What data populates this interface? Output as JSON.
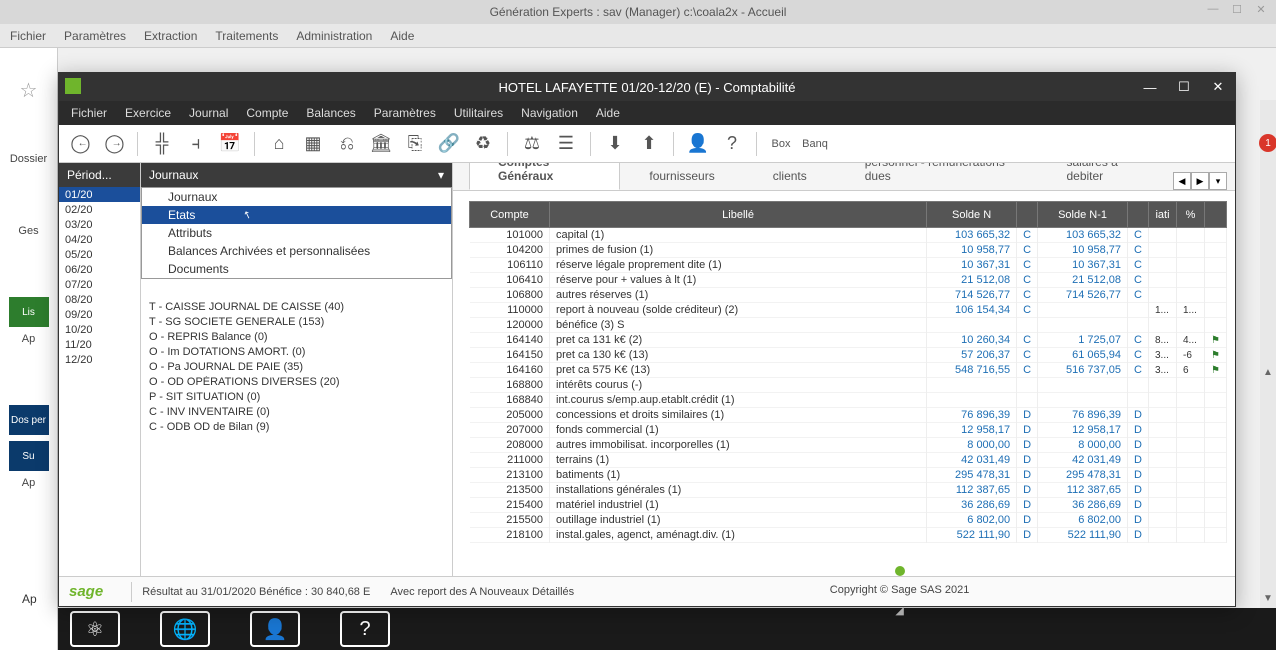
{
  "outer": {
    "title": "Génération Experts : sav (Manager) c:\\coala2x - Accueil",
    "menu": [
      "Fichier",
      "Paramètres",
      "Extraction",
      "Traitements",
      "Administration",
      "Aide"
    ]
  },
  "left": {
    "labels": [
      "Dossier",
      "Ges",
      "Lis",
      "Ap",
      "Dos per",
      "Su",
      "Ap"
    ]
  },
  "inner": {
    "title": "HOTEL LAFAYETTE 01/20-12/20 (E) - Comptabilité",
    "menu": [
      "Fichier",
      "Exercice",
      "Journal",
      "Compte",
      "Balances",
      "Paramètres",
      "Utilitaires",
      "Navigation",
      "Aide"
    ]
  },
  "toolbar_icons": [
    "arrow-left",
    "arrow-right",
    "split-h",
    "split-v",
    "calendar",
    "home",
    "grid",
    "org",
    "bank",
    "export",
    "link",
    "recycle",
    "scale",
    "list",
    "download",
    "upload",
    "person",
    "help",
    "box",
    "banq"
  ],
  "periods": {
    "header": "Périod...",
    "items": [
      "01/20",
      "02/20",
      "03/20",
      "04/20",
      "05/20",
      "06/20",
      "07/20",
      "08/20",
      "09/20",
      "10/20",
      "11/20",
      "12/20"
    ],
    "selected": "01/20"
  },
  "journaux": {
    "combo": "Journaux",
    "dropdown": [
      "Journaux",
      "Etats",
      "Attributs",
      "Balances Archivées et personnalisées",
      "Documents"
    ],
    "dropdown_selected": "Etats",
    "list": [
      "T - CAISSE JOURNAL DE CAISSE (40)",
      "T - SG SOCIETE GENERALE (153)",
      "O - REPRIS Balance (0)",
      "O - Im DOTATIONS AMORT. (0)",
      "O - Pa JOURNAL DE PAIE (35)",
      "O - OD OPÉRATIONS DIVERSES (20)",
      "P - SIT SITUATION (0)",
      "C - INV INVENTAIRE (0)",
      "C - ODB OD de Bilan (9)"
    ]
  },
  "tabs": {
    "items": [
      "Comptes Généraux",
      "fournisseurs",
      "clients",
      "personnel - rémunérations dues",
      "salaires a debiter"
    ],
    "active": "Comptes Généraux"
  },
  "table": {
    "headers": [
      "Compte",
      "Libellé",
      "Solde N",
      "",
      "Solde N-1",
      "",
      "iati",
      "%",
      ""
    ],
    "rows": [
      {
        "c": "101000",
        "l": "capital (1)",
        "n": "103 665,32",
        "cd": "C",
        "n1": "103 665,32",
        "cd1": "C",
        "a": "",
        "b": "",
        "f": ""
      },
      {
        "c": "104200",
        "l": "primes de fusion (1)",
        "n": "10 958,77",
        "cd": "C",
        "n1": "10 958,77",
        "cd1": "C",
        "a": "",
        "b": "",
        "f": ""
      },
      {
        "c": "106110",
        "l": "réserve légale proprement dite (1)",
        "n": "10 367,31",
        "cd": "C",
        "n1": "10 367,31",
        "cd1": "C",
        "a": "",
        "b": "",
        "f": ""
      },
      {
        "c": "106410",
        "l": "réserve pour + values à lt (1)",
        "n": "21 512,08",
        "cd": "C",
        "n1": "21 512,08",
        "cd1": "C",
        "a": "",
        "b": "",
        "f": ""
      },
      {
        "c": "106800",
        "l": "autres réserves (1)",
        "n": "714 526,77",
        "cd": "C",
        "n1": "714 526,77",
        "cd1": "C",
        "a": "",
        "b": "",
        "f": ""
      },
      {
        "c": "110000",
        "l": "report à nouveau (solde créditeur) (2)",
        "n": "106 154,34",
        "cd": "C",
        "n1": "",
        "cd1": "",
        "a": "1...",
        "b": "1...",
        "f": ""
      },
      {
        "c": "120000",
        "l": "bénéfice (3) S",
        "n": "",
        "cd": "",
        "n1": "",
        "cd1": "",
        "a": "",
        "b": "",
        "f": ""
      },
      {
        "c": "164140",
        "l": "pret ca 131 k€  (2)",
        "n": "10 260,34",
        "cd": "C",
        "n1": "1 725,07",
        "cd1": "C",
        "a": "8...",
        "b": "4...",
        "f": "⚑"
      },
      {
        "c": "164150",
        "l": "pret ca 130 k€ (13)",
        "n": "57 206,37",
        "cd": "C",
        "n1": "61 065,94",
        "cd1": "C",
        "a": "3...",
        "b": "-6",
        "f": "⚑"
      },
      {
        "c": "164160",
        "l": "pret ca 575 K€ (13)",
        "n": "548 716,55",
        "cd": "C",
        "n1": "516 737,05",
        "cd1": "C",
        "a": "3...",
        "b": "6",
        "f": "⚑"
      },
      {
        "c": "168800",
        "l": "intérêts courus (-)",
        "n": "",
        "cd": "",
        "n1": "",
        "cd1": "",
        "a": "",
        "b": "",
        "f": ""
      },
      {
        "c": "168840",
        "l": "int.courus s/emp.aup.etablt.crédit (1)",
        "n": "",
        "cd": "",
        "n1": "",
        "cd1": "",
        "a": "",
        "b": "",
        "f": ""
      },
      {
        "c": "205000",
        "l": "concessions et droits similaires (1)",
        "n": "76 896,39",
        "cd": "D",
        "n1": "76 896,39",
        "cd1": "D",
        "a": "",
        "b": "",
        "f": ""
      },
      {
        "c": "207000",
        "l": "fonds commercial (1)",
        "n": "12 958,17",
        "cd": "D",
        "n1": "12 958,17",
        "cd1": "D",
        "a": "",
        "b": "",
        "f": ""
      },
      {
        "c": "208000",
        "l": "autres immobilisat. incorporelles (1)",
        "n": "8 000,00",
        "cd": "D",
        "n1": "8 000,00",
        "cd1": "D",
        "a": "",
        "b": "",
        "f": ""
      },
      {
        "c": "211000",
        "l": "terrains (1)",
        "n": "42 031,49",
        "cd": "D",
        "n1": "42 031,49",
        "cd1": "D",
        "a": "",
        "b": "",
        "f": ""
      },
      {
        "c": "213100",
        "l": "batiments (1)",
        "n": "295 478,31",
        "cd": "D",
        "n1": "295 478,31",
        "cd1": "D",
        "a": "",
        "b": "",
        "f": ""
      },
      {
        "c": "213500",
        "l": "installations générales (1)",
        "n": "112 387,65",
        "cd": "D",
        "n1": "112 387,65",
        "cd1": "D",
        "a": "",
        "b": "",
        "f": ""
      },
      {
        "c": "215400",
        "l": "matériel industriel (1)",
        "n": "36 286,69",
        "cd": "D",
        "n1": "36 286,69",
        "cd1": "D",
        "a": "",
        "b": "",
        "f": ""
      },
      {
        "c": "215500",
        "l": "outillage industriel (1)",
        "n": "6 802,00",
        "cd": "D",
        "n1": "6 802,00",
        "cd1": "D",
        "a": "",
        "b": "",
        "f": ""
      },
      {
        "c": "218100",
        "l": "instal.gales, agenct, aménagt.div. (1)",
        "n": "522 111,90",
        "cd": "D",
        "n1": "522 111,90",
        "cd1": "D",
        "a": "",
        "b": "",
        "f": ""
      }
    ]
  },
  "status": {
    "logo": "sage",
    "result": "Résultat au 31/01/2020 Bénéfice : 30 840,68 E",
    "report": "Avec report des A Nouveaux Détaillés",
    "copyright": "Copyright © Sage SAS 2021"
  }
}
